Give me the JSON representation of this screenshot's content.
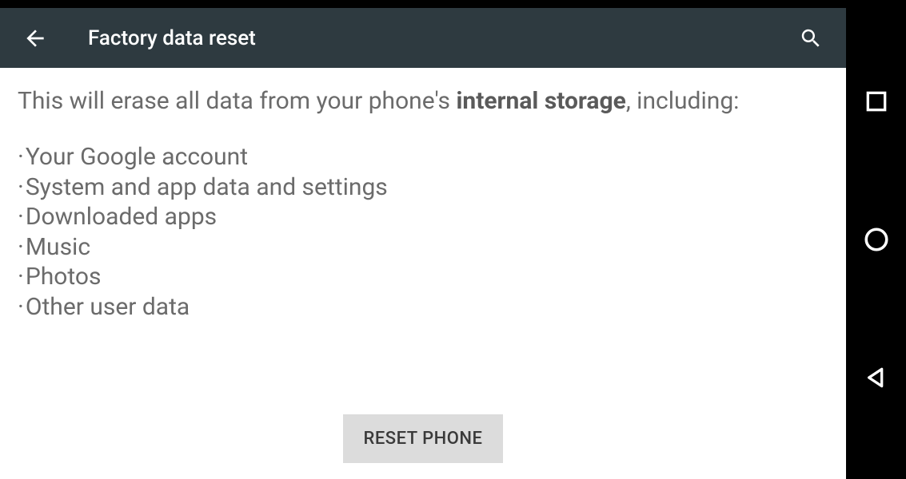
{
  "header": {
    "title": "Factory data reset"
  },
  "content": {
    "intro_prefix": "This will erase all data from your phone's ",
    "intro_bold": "internal storage",
    "intro_suffix": ", including:",
    "items": [
      "Your Google account",
      "System and app data and settings",
      "Downloaded apps",
      "Music",
      "Photos",
      "Other user data"
    ]
  },
  "button": {
    "reset_label": "RESET PHONE"
  }
}
